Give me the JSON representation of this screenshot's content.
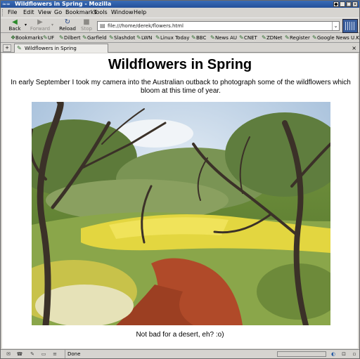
{
  "window": {
    "title": "Wildflowers in Spring - Mozilla",
    "icon_text": "≈∞",
    "controls": [
      "◆",
      "_",
      "□",
      "×"
    ]
  },
  "menu": [
    "File",
    "Edit",
    "View",
    "Go",
    "Bookmarks",
    "Tools",
    "Window",
    "Help"
  ],
  "toolbar": {
    "back": "Back",
    "forward": "Forward",
    "reload": "Reload",
    "stop": "Stop",
    "url": "file:///home/derek/flowers.html",
    "url_drop": "⌄"
  },
  "bookmarks": {
    "label": "Bookmarks",
    "items": [
      "UF",
      "Dilbert",
      "Garfield",
      "Slashdot",
      "LWN",
      "Linux Today",
      "BBC",
      "News AU",
      "CNET",
      "ZDNet",
      "Register",
      "Google News U.K."
    ]
  },
  "tabs": {
    "new_tab": "+",
    "active": "Wildflowers in Spring",
    "close": "×"
  },
  "page": {
    "title": "Wildflowers in Spring",
    "intro": "In early September I took my camera into the Australian outback to photograph some of the wildflowers which bloom at this time of year.",
    "caption": "Not bad for a desert, eh? :o)"
  },
  "status": {
    "text": "Done",
    "icons": [
      "✉",
      "☎",
      "✎",
      "▭",
      "≡"
    ]
  },
  "colors": {
    "titlebar": "#2f5ea8",
    "chrome": "#d6d4d0",
    "page_bg": "#ffffff",
    "sky": "#b7cde4",
    "wildflowers": "#e8d63a",
    "red_soil": "#b24a2a"
  }
}
